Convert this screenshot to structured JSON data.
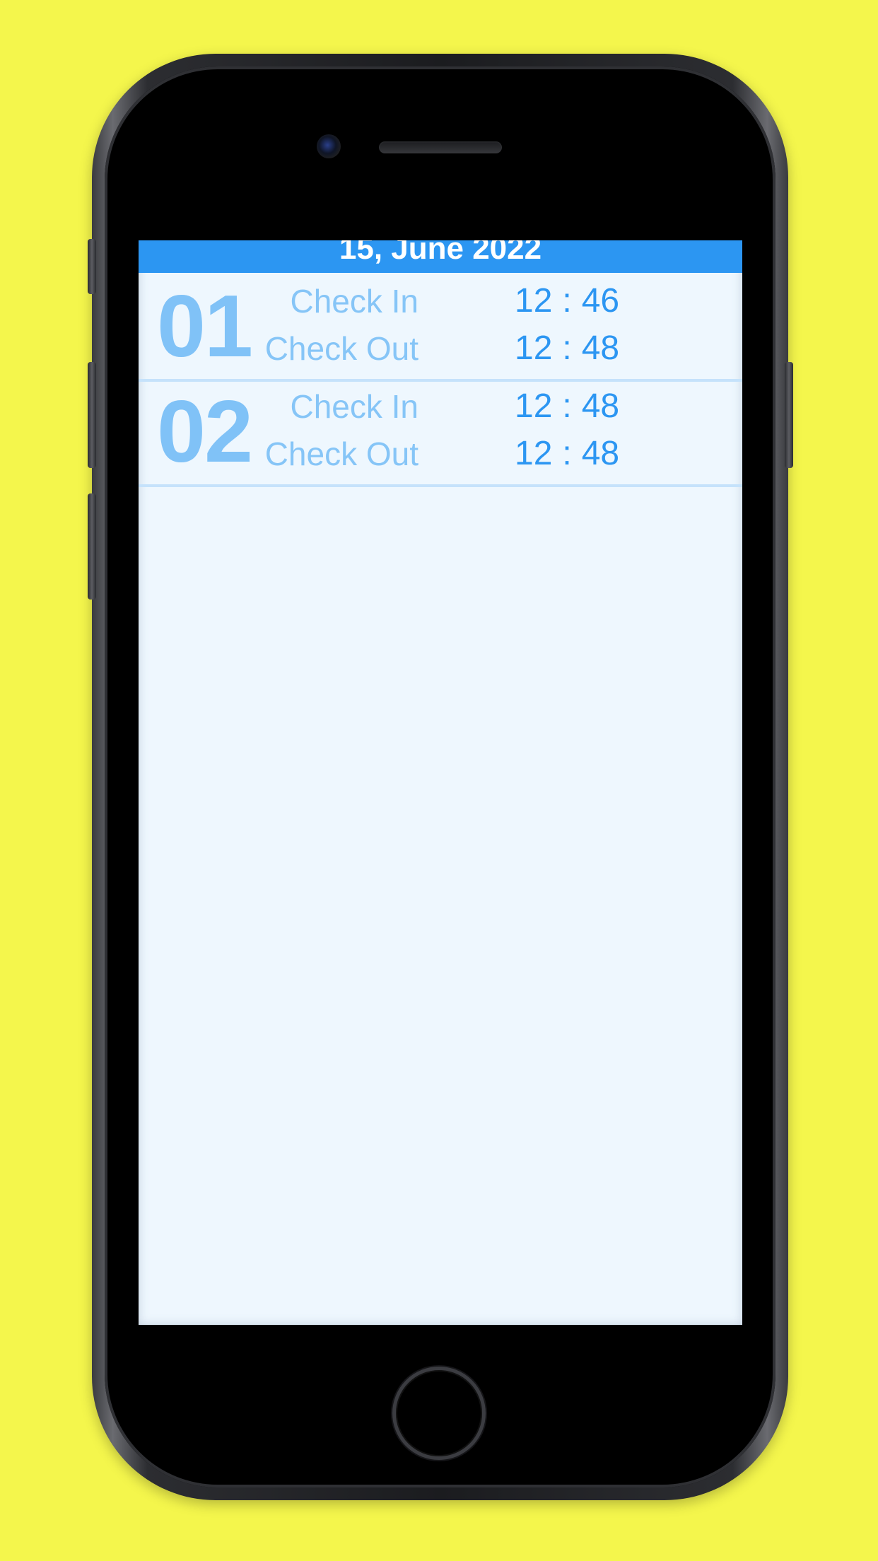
{
  "header": {
    "date": "15, June 2022"
  },
  "records": [
    {
      "number": "01",
      "check_in_label": "Check In",
      "check_in": {
        "hour": "12",
        "minute": "46"
      },
      "check_out_label": "Check Out",
      "check_out": {
        "hour": "12",
        "minute": "48"
      }
    },
    {
      "number": "02",
      "check_in_label": "Check In",
      "check_in": {
        "hour": "12",
        "minute": "48"
      },
      "check_out_label": "Check Out",
      "check_out": {
        "hour": "12",
        "minute": "48"
      }
    }
  ],
  "time_separator": ":",
  "colors": {
    "background": "#f4f64c",
    "header": "#2c96f2",
    "screen": "#eef7fe",
    "number": "#80c2f7",
    "label": "#86c5f7",
    "time": "#2c96f2"
  }
}
